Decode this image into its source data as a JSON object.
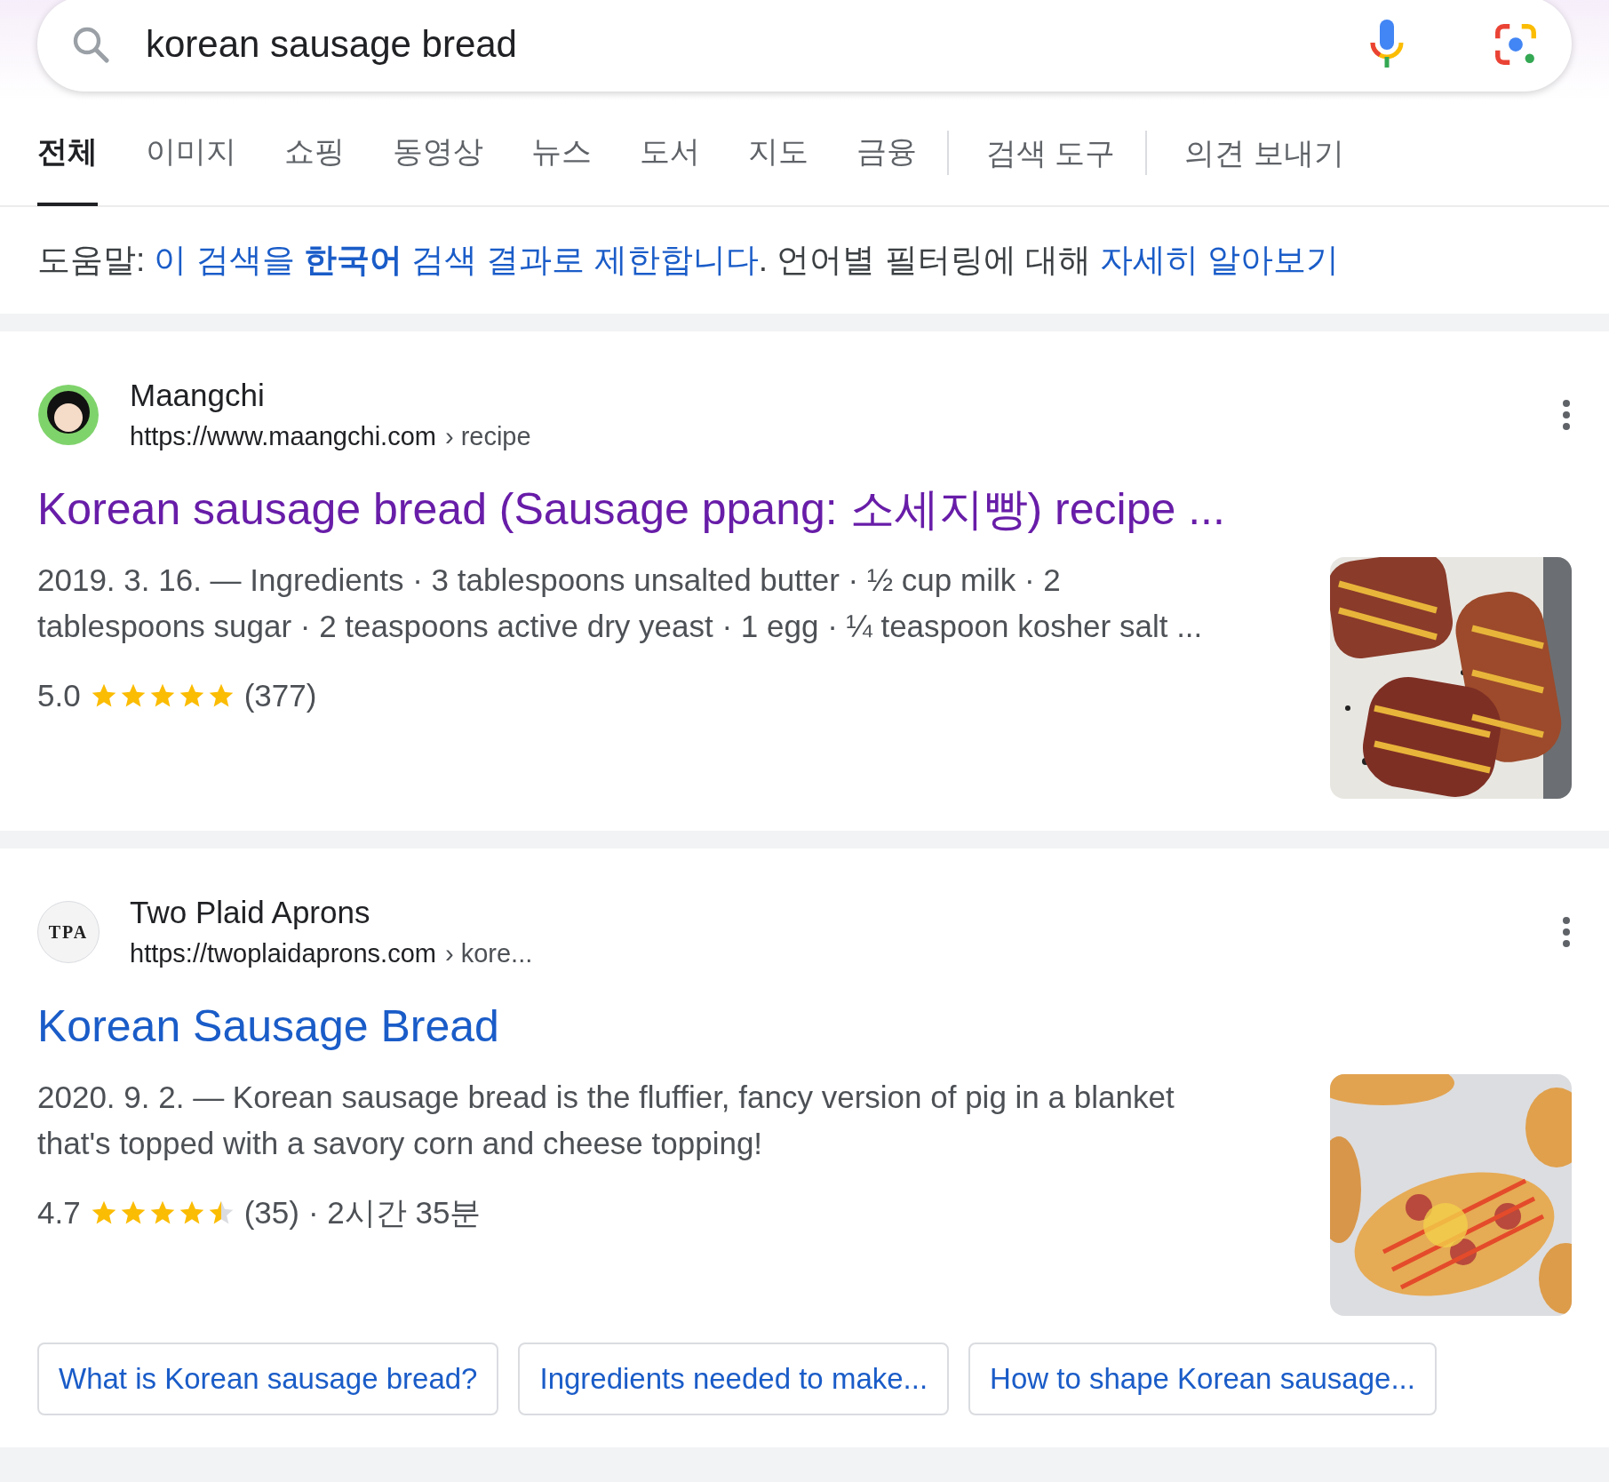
{
  "search": {
    "value": "korean sausage bread"
  },
  "tabs": [
    {
      "label": "전체",
      "selected": true
    },
    {
      "label": "이미지",
      "selected": false
    },
    {
      "label": "쇼핑",
      "selected": false
    },
    {
      "label": "동영상",
      "selected": false
    },
    {
      "label": "뉴스",
      "selected": false
    },
    {
      "label": "도서",
      "selected": false
    },
    {
      "label": "지도",
      "selected": false
    },
    {
      "label": "금융",
      "selected": false
    }
  ],
  "tools": [
    "검색 도구",
    "의견 보내기"
  ],
  "notice": {
    "prefix": "도움말: ",
    "link": "이 검색을 **한국어** 검색 결과로 제한합니다",
    "middle": ". 언어별 필터링에 대해 ",
    "more_link": "자세히 알아보기"
  },
  "results": [
    {
      "favicon": {
        "kind": "avatar"
      },
      "site": "Maangchi",
      "url": "https://www.maangchi.com",
      "path": "› recipe",
      "title": "Korean sausage bread (Sausage ppang: 소세지빵) recipe ...",
      "visited": true,
      "snippet": "2019. 3. 16. — Ingredients · 3 tablespoons unsalted butter · ½ cup milk · 2 tablespoons sugar · 2 teaspoons active dry yeast · 1 egg · ¼ teaspoon kosher salt ...",
      "rating": "5.0",
      "stars": 5,
      "count": "(377)"
    },
    {
      "favicon": {
        "kind": "text",
        "text": "TPA"
      },
      "site": "Two Plaid Aprons",
      "url": "https://twoplaidaprons.com",
      "path": "› kore...",
      "title": "Korean Sausage Bread",
      "visited": false,
      "snippet": "2020. 9. 2. — Korean sausage bread is the fluffier, fancy version of pig in a blanket that's topped with a savory corn and cheese topping!",
      "rating": "4.7",
      "stars": 4.5,
      "count": "(35)",
      "extra": "· 2시간 35분",
      "chips": [
        "What is Korean sausage bread?",
        "Ingredients needed to make...",
        "How to shape Korean sausage..."
      ]
    }
  ]
}
